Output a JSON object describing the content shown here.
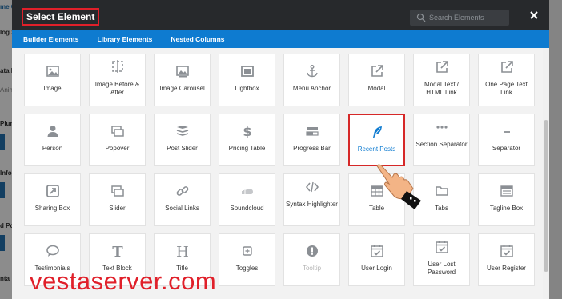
{
  "background": {
    "left_items": [
      "me Co",
      "log S",
      "ata P",
      "Anim",
      "Pluri",
      "Info",
      "d Pos",
      "nta"
    ],
    "right_items": [
      "o",
      "ig",
      "Y",
      "B",
      "ibr"
    ]
  },
  "modal": {
    "title": "Select Element",
    "search": {
      "placeholder": "Search Elements",
      "icon": "search-icon"
    },
    "close_icon": "close-icon"
  },
  "tabs": [
    {
      "label": "Builder Elements",
      "active": true
    },
    {
      "label": "Library Elements",
      "active": false
    },
    {
      "label": "Nested Columns",
      "active": false
    }
  ],
  "elements": [
    {
      "label": "Image",
      "icon": "image-icon"
    },
    {
      "label": "Image Before & After",
      "icon": "image-compare-icon"
    },
    {
      "label": "Image Carousel",
      "icon": "carousel-icon"
    },
    {
      "label": "Lightbox",
      "icon": "lightbox-icon"
    },
    {
      "label": "Menu Anchor",
      "icon": "anchor-icon"
    },
    {
      "label": "Modal",
      "icon": "external-link-icon"
    },
    {
      "label": "Modal Text / HTML Link",
      "icon": "external-link-icon"
    },
    {
      "label": "One Page Text Link",
      "icon": "external-link-icon"
    },
    {
      "label": "Person",
      "icon": "person-icon"
    },
    {
      "label": "Popover",
      "icon": "popover-icon"
    },
    {
      "label": "Post Slider",
      "icon": "layers-icon"
    },
    {
      "label": "Pricing Table",
      "icon": "dollar-icon"
    },
    {
      "label": "Progress Bar",
      "icon": "progress-bar-icon"
    },
    {
      "label": "Recent Posts",
      "icon": "feather-icon"
    },
    {
      "label": "Section Separator",
      "icon": "dots-icon"
    },
    {
      "label": "Separator",
      "icon": "dash-icon"
    },
    {
      "label": "Sharing Box",
      "icon": "share-box-icon"
    },
    {
      "label": "Slider",
      "icon": "slider-icon"
    },
    {
      "label": "Social Links",
      "icon": "link-icon"
    },
    {
      "label": "Soundcloud",
      "icon": "cloud-icon"
    },
    {
      "label": "Syntax Highlighter",
      "icon": "code-icon"
    },
    {
      "label": "Table",
      "icon": "table-icon"
    },
    {
      "label": "Tabs",
      "icon": "folder-icon"
    },
    {
      "label": "Tagline Box",
      "icon": "tagline-icon"
    },
    {
      "label": "Testimonials",
      "icon": "speech-bubble-icon"
    },
    {
      "label": "Text Block",
      "icon": "text-t-icon"
    },
    {
      "label": "Title",
      "icon": "heading-icon"
    },
    {
      "label": "Toggles",
      "icon": "plus-square-icon"
    },
    {
      "label": "Tooltip",
      "icon": "exclamation-circle-icon"
    },
    {
      "label": "User Login",
      "icon": "calendar-check-icon"
    },
    {
      "label": "User Lost Password",
      "icon": "calendar-check-icon"
    },
    {
      "label": "User Register",
      "icon": "calendar-check-icon"
    }
  ],
  "highlighted": "Recent Posts",
  "watermark": "vestaserver.com",
  "colors": {
    "header_bg": "#27292c",
    "tab_bar": "#0e7bd0",
    "highlight_border": "#d62828",
    "watermark": "#e0202a",
    "icon_gray": "#8b8f94"
  }
}
